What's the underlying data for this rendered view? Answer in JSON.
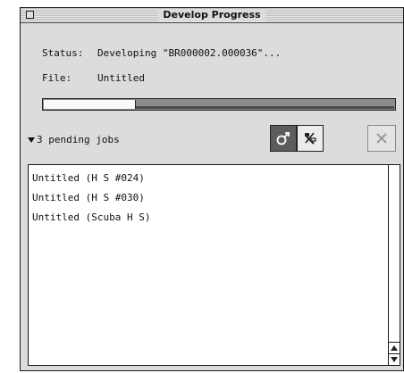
{
  "window": {
    "title": "Develop Progress"
  },
  "status": {
    "label": "Status:",
    "value": "Developing \"BR000002.000036\"..."
  },
  "file": {
    "label": "File:",
    "value": "Untitled"
  },
  "progress": {
    "fraction": 0.26
  },
  "pending": {
    "label": "3 pending jobs",
    "items": [
      "Untitled (H S #024)",
      "Untitled (H S #030)",
      "Untitled (Scuba H S)"
    ]
  },
  "icons": {
    "disclosure": "disclosure-triangle-icon",
    "tool1": "sex-symbol-icon",
    "tool2": "wrench-crossed-icon",
    "cancel": "close-x-icon"
  }
}
